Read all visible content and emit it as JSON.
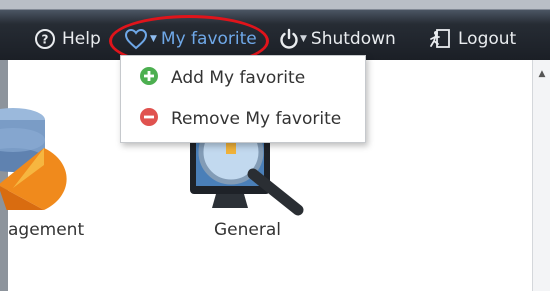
{
  "toolbar": {
    "help_label": "Help",
    "favorite_label": "My favorite",
    "shutdown_label": "Shutdown",
    "logout_label": "Logout"
  },
  "favorite_menu": {
    "items": [
      {
        "label": "Add My favorite",
        "icon": "add-circle-icon",
        "color": "#4caf50"
      },
      {
        "label": "Remove My favorite",
        "icon": "remove-circle-icon",
        "color": "#e0524f"
      }
    ]
  },
  "apps": [
    {
      "label": "agement",
      "icon": "management-icon"
    },
    {
      "label": "General",
      "icon": "general-settings-icon"
    }
  ],
  "colors": {
    "highlight": "#e0141b",
    "active_menu_text": "#6fa8e8",
    "toolbar_bg": "#1b1f26"
  }
}
